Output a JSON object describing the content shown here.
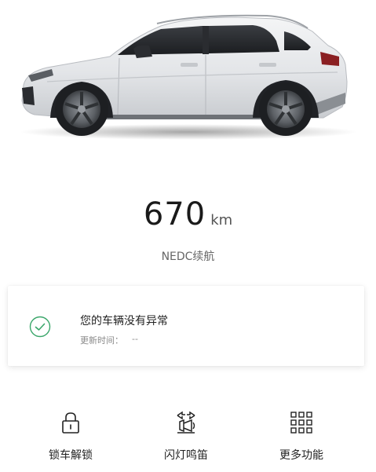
{
  "vehicle": {
    "image": "audi-q3-side-view-image"
  },
  "range": {
    "value": "670",
    "unit": "km",
    "label": "NEDC续航"
  },
  "status": {
    "icon": "check-circle-icon",
    "title": "您的车辆没有异常",
    "update_label": "更新时间：",
    "update_value": "--",
    "colors": {
      "check": "#3aa66a"
    }
  },
  "actions": [
    {
      "icon": "lock-icon",
      "label": "锁车解锁"
    },
    {
      "icon": "flash-horn-icon",
      "label": "闪灯鸣笛"
    },
    {
      "icon": "grid-icon",
      "label": "更多功能"
    }
  ]
}
